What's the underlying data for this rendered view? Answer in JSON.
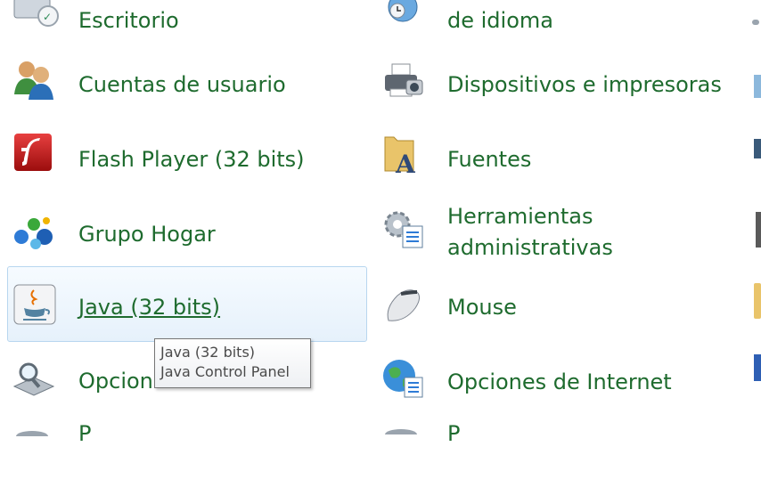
{
  "col1": [
    {
      "label": "Escritorio",
      "icon": "desktop-gadget-icon"
    },
    {
      "label": "Cuentas de usuario",
      "icon": "user-accounts-icon"
    },
    {
      "label": "Flash Player (32 bits)",
      "icon": "flash-player-icon"
    },
    {
      "label": "Grupo Hogar",
      "icon": "homegroup-icon"
    },
    {
      "label": "Java (32 bits)",
      "icon": "java-icon"
    },
    {
      "label": "Opcion",
      "icon": "indexing-options-icon"
    },
    {
      "label": "P",
      "icon": "partial-icon"
    }
  ],
  "col2": [
    {
      "label": "de idioma",
      "icon": "region-language-icon"
    },
    {
      "label": "Dispositivos e impresoras",
      "icon": "devices-printers-icon"
    },
    {
      "label": "Fuentes",
      "icon": "fonts-folder-icon"
    },
    {
      "label_line1": "Herramientas",
      "label_line2": "administrativas",
      "icon": "admin-tools-icon"
    },
    {
      "label": "Mouse",
      "icon": "mouse-icon"
    },
    {
      "label": "Opciones de Internet",
      "icon": "internet-options-icon"
    },
    {
      "label": "P",
      "icon": "partial-icon"
    }
  ],
  "tooltip": {
    "title": "Java (32 bits)",
    "description": "Java Control Panel"
  },
  "colors": {
    "link": "#1e6b2e",
    "hover_border": "#b8d6ef",
    "hover_bg": "#e6f1fb"
  }
}
